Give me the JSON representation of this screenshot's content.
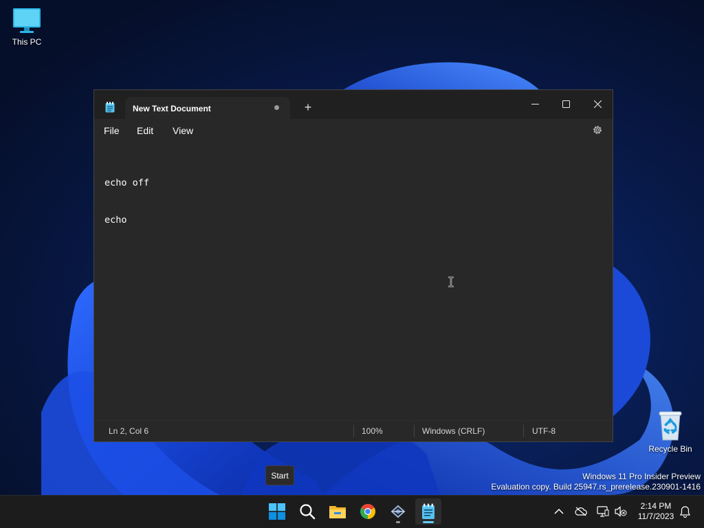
{
  "desktop": {
    "icons": [
      {
        "label": "This PC",
        "icon": "monitor-icon"
      },
      {
        "label": "Recycle Bin",
        "icon": "recycle-bin-icon"
      }
    ],
    "tooltip": "Start",
    "watermark": {
      "line1": "Windows 11 Pro Insider Preview",
      "line2": "Evaluation copy. Build 25947.rs_prerelease.230901-1416"
    }
  },
  "window": {
    "tab": {
      "title": "New Text Document",
      "unsaved": true
    },
    "new_tab_label": "+",
    "menu": [
      "File",
      "Edit",
      "View"
    ],
    "editor": {
      "lines": [
        "echo off",
        "echo"
      ]
    },
    "status": {
      "position": "Ln 2, Col 6",
      "zoom": "100%",
      "line_ending": "Windows (CRLF)",
      "encoding": "UTF-8"
    }
  },
  "taskbar": {
    "apps": [
      "start-icon",
      "search-icon",
      "file-explorer-icon",
      "chrome-icon",
      "app-icon",
      "notepad-icon"
    ],
    "clock": {
      "time": "2:14 PM",
      "date": "11/7/2023"
    }
  },
  "colors": {
    "accent": "#60cdff",
    "window_bg": "#282828",
    "titlebar_bg": "#202020",
    "taskbar_bg": "#1c1c1c"
  }
}
